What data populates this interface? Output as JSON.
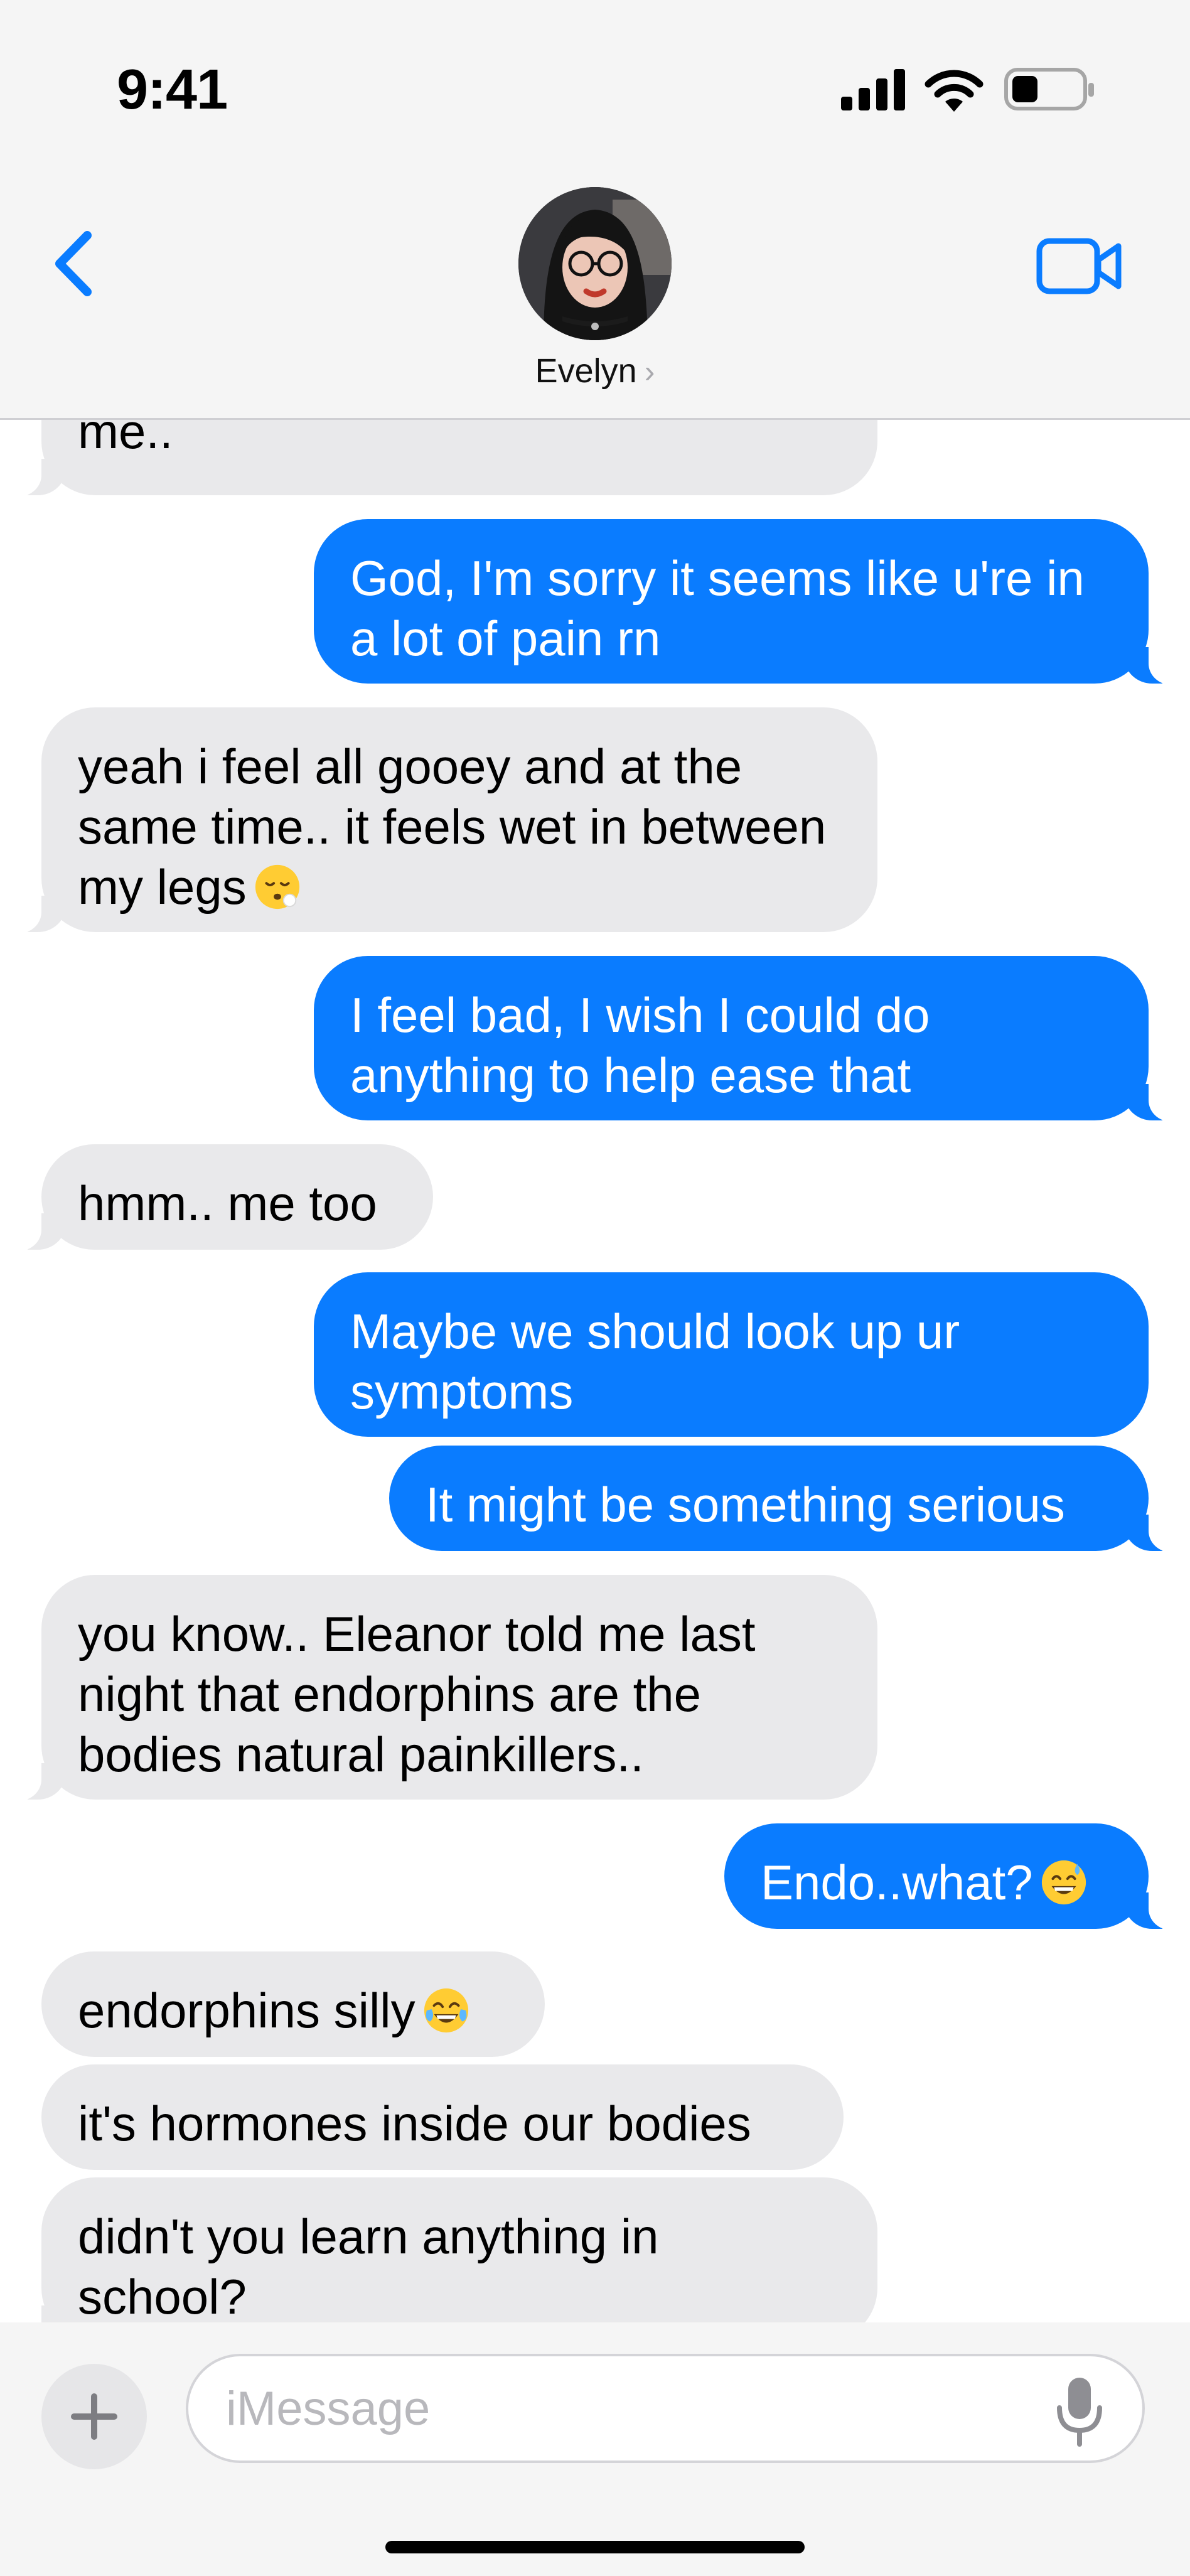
{
  "status_bar": {
    "time": "9:41"
  },
  "header": {
    "back_icon": "chevron-left-icon",
    "contact_name": "Evelyn",
    "contact_chevron": "›",
    "video_icon": "video-camera-icon"
  },
  "colors": {
    "accent": "#0a7cff",
    "incoming_bubble": "#e9e9eb",
    "header_bg": "#f5f5f5"
  },
  "messages": [
    {
      "from": "them",
      "text": "me..",
      "emoji": ""
    },
    {
      "from": "me",
      "text": "God, I'm sorry it seems like u're in a lot of pain rn",
      "emoji": ""
    },
    {
      "from": "them",
      "text": "yeah i feel all gooey and at the same time.. it feels wet in between my legs",
      "emoji": "face-exhaling"
    },
    {
      "from": "me",
      "text": "I feel bad, I wish I could do anything to help ease that",
      "emoji": ""
    },
    {
      "from": "them",
      "text": "hmm.. me too",
      "emoji": ""
    },
    {
      "from": "me",
      "text": "Maybe we should look up ur symptoms",
      "emoji": ""
    },
    {
      "from": "me",
      "text": "It might be something serious",
      "emoji": ""
    },
    {
      "from": "them",
      "text": "you know.. Eleanor told me last night that endorphins are the bodies natural painkillers..",
      "emoji": ""
    },
    {
      "from": "me",
      "text": "Endo..what?",
      "emoji": "grinning-sweat"
    },
    {
      "from": "them",
      "text": "endorphins silly",
      "emoji": "tears-of-joy"
    },
    {
      "from": "them",
      "text": "it's hormones inside our bodies",
      "emoji": ""
    },
    {
      "from": "them",
      "text": "didn't you learn anything in school?",
      "emoji": ""
    }
  ],
  "composer": {
    "plus_icon": "plus-icon",
    "placeholder": "iMessage",
    "value": "",
    "mic_icon": "microphone-icon"
  }
}
